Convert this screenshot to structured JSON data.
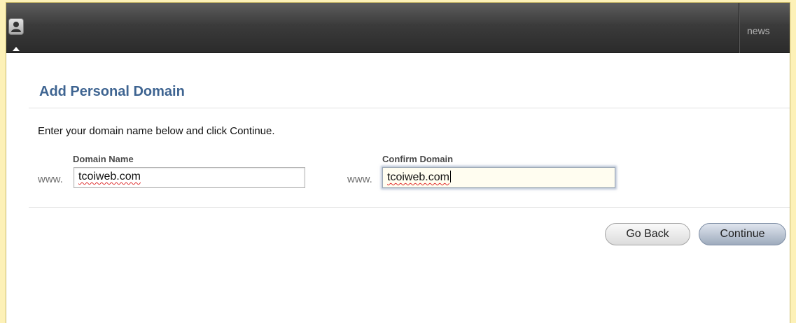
{
  "topbar": {
    "news_label": "news"
  },
  "form": {
    "title": "Add Personal Domain",
    "instructions": "Enter your domain name below and click Continue.",
    "domain_name": {
      "label": "Domain Name",
      "prefix": "www.",
      "value": "tcoiweb.com"
    },
    "confirm_domain": {
      "label": "Confirm Domain",
      "prefix": "www.",
      "value": "tcoiweb.com"
    }
  },
  "buttons": {
    "back_label": "Go Back",
    "continue_label": "Continue"
  },
  "colors": {
    "background": "#fdf1b7",
    "topbar": "#3b3b3b",
    "title": "#3e6491"
  },
  "icons": {
    "user": "user-icon"
  }
}
